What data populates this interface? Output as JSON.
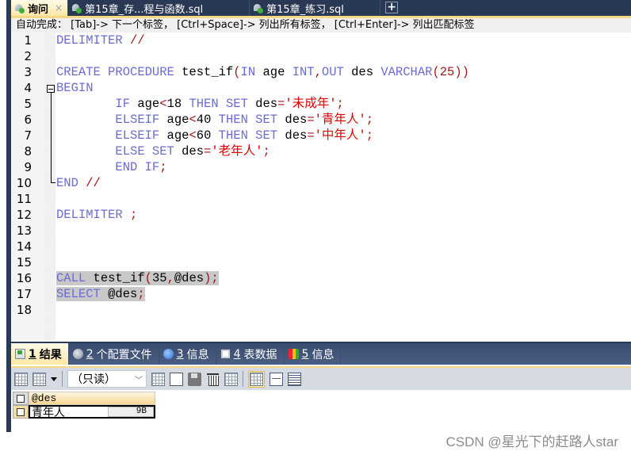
{
  "tabs": [
    {
      "label": "询问",
      "active": true,
      "close": "×"
    },
    {
      "label": "第15章_存...程与函数.sql",
      "active": false
    },
    {
      "label": "第15章_练习.sql",
      "active": false
    }
  ],
  "add_tab_label": "+",
  "hint": "自动完成： [Tab]-> 下一个标签， [Ctrl+Space]-> 列出所有标签， [Ctrl+Enter]-> 列出匹配标签",
  "editor": {
    "line_numbers": [
      "1",
      "2",
      "3",
      "4",
      "5",
      "6",
      "7",
      "8",
      "9",
      "10",
      "11",
      "12",
      "13",
      "14",
      "15",
      "16",
      "17",
      "18"
    ],
    "lines": {
      "l1": {
        "kw": "DELIMITER",
        "op": " //"
      },
      "l3": {
        "a": "CREATE PROCEDURE",
        "b": " test_if",
        "c": "(",
        "d": "IN",
        "e": " age ",
        "f": "INT",
        "g": ",",
        "h": "OUT",
        "i": " des ",
        "j": "VARCHAR",
        "k": "(25))"
      },
      "l4": {
        "kw": "BEGIN"
      },
      "l5": {
        "a": "        IF",
        "b": " age",
        "c": "<",
        "d": "18 ",
        "e": "THEN SET",
        "f": " des",
        "g": "=",
        "h": "'未成年'",
        "i": ";"
      },
      "l6": {
        "a": "        ELSEIF",
        "b": " age",
        "c": "<",
        "d": "40 ",
        "e": "THEN SET",
        "f": " des",
        "g": "=",
        "h": "'青年人'",
        "i": ";"
      },
      "l7": {
        "a": "        ELSEIF",
        "b": " age",
        "c": "<",
        "d": "60 ",
        "e": "THEN SET",
        "f": " des",
        "g": "=",
        "h": "'中年人'",
        "i": ";"
      },
      "l8": {
        "a": "        ELSE SET",
        "b": " des",
        "c": "=",
        "d": "'老年人'",
        "e": ";"
      },
      "l9": {
        "a": "        END IF",
        "b": ";"
      },
      "l10": {
        "kw": "END",
        "op": " //"
      },
      "l12": {
        "kw": "DELIMITER",
        "op": " ;"
      },
      "l16": {
        "a": "CALL",
        "b": " test_if",
        "c": "(",
        "d": "35",
        "e": ",",
        "f": "@des",
        "g": ");"
      },
      "l17": {
        "a": "SELECT",
        "b": " @des",
        "c": ";"
      }
    }
  },
  "result_tabs": [
    {
      "num": "1",
      "label": " 结果",
      "icon": "result-grid-icon",
      "active": true
    },
    {
      "num": "2",
      "label": " 个配置文件",
      "icon": "profile-icon",
      "active": false
    },
    {
      "num": "3",
      "label": " 信息",
      "icon": "info-icon",
      "active": false
    },
    {
      "num": "4",
      "label": " 表数据",
      "icon": "table-data-icon",
      "active": false
    },
    {
      "num": "5",
      "label": " 信息",
      "icon": "info-status-icon",
      "active": false
    }
  ],
  "result_toolbar": {
    "mode_value": "（只读）"
  },
  "result_grid": {
    "column": "@des",
    "rows": [
      {
        "value": "青年人",
        "size": "9B"
      }
    ]
  },
  "watermark": "CSDN @星光下的赶路人star"
}
